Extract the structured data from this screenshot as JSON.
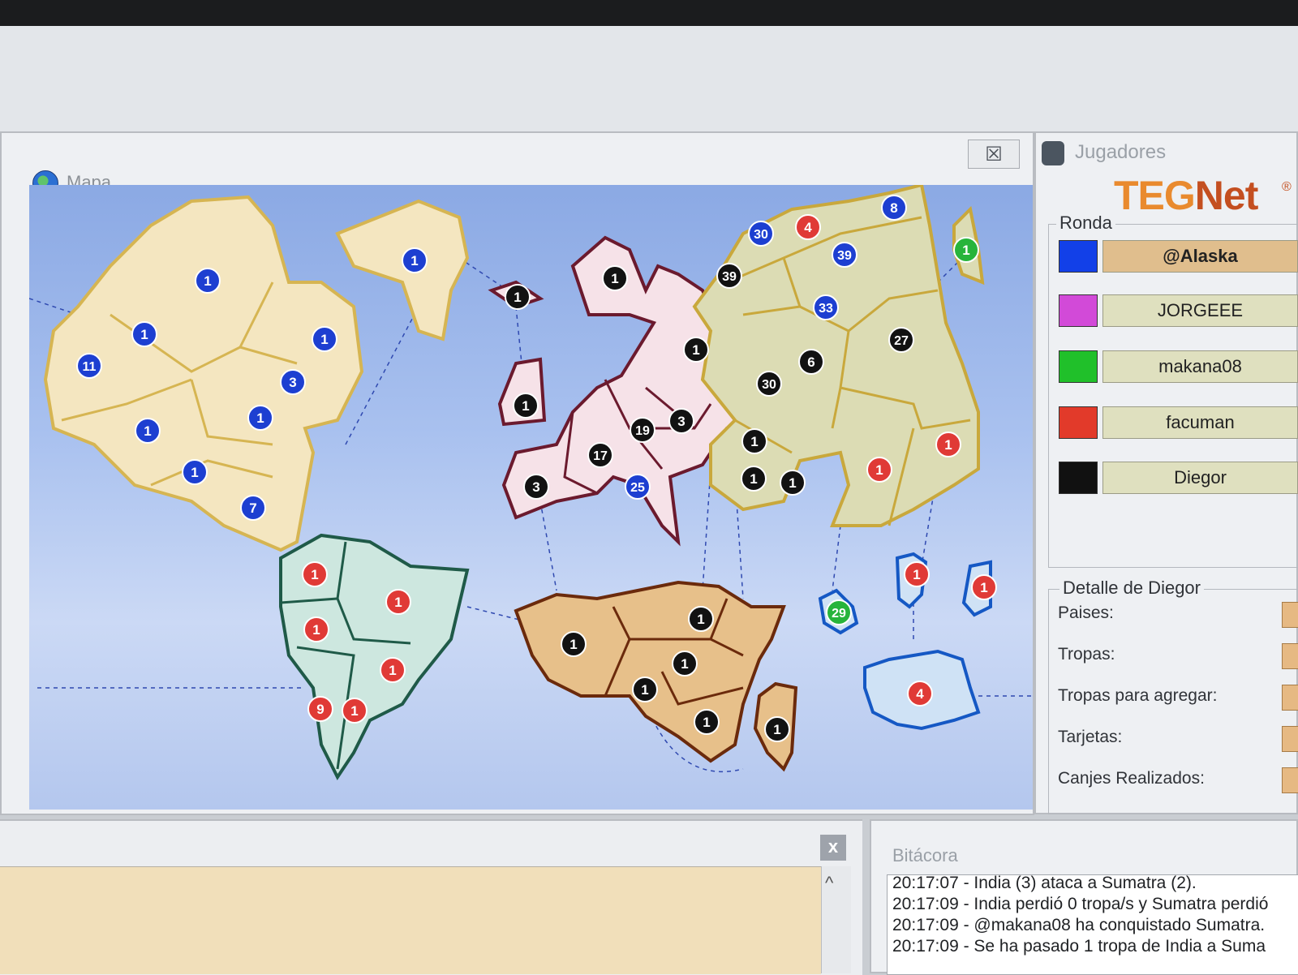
{
  "map_window": {
    "title": "Mapa",
    "close_label": "☒"
  },
  "players_window": {
    "title": "Jugadores",
    "brand_a": "TEG",
    "brand_b": "Net",
    "brand_mark": "®",
    "ronda_label": "Ronda",
    "players": [
      {
        "name": "@Alaska",
        "color": "#1240e8",
        "active": true
      },
      {
        "name": "JORGEEE",
        "color": "#d24ad8",
        "active": false
      },
      {
        "name": "makana08",
        "color": "#20c02a",
        "active": false
      },
      {
        "name": "facuman",
        "color": "#e23a2a",
        "active": false
      },
      {
        "name": "Diegor",
        "color": "#111111",
        "active": false
      }
    ],
    "detalle_label": "Detalle de Diegor",
    "stats": [
      "Paises:",
      "Tropas:",
      "Tropas para agregar:",
      "Tarjetas:",
      "Canjes Realizados:"
    ]
  },
  "chat_window": {
    "close_label": "x",
    "scroll_up": "^"
  },
  "log_window": {
    "title": "Bitácora",
    "lines": [
      "20:17:07 - India (3) ataca a Sumatra (2).",
      "20:17:09 - India perdió 0 tropa/s y Sumatra perdió",
      "20:17:09 - @makana08 ha conquistado Sumatra.",
      "20:17:09 - Se ha pasado 1 tropa de India a Suma"
    ]
  },
  "map": {
    "colors": {
      "blue": "#1d3fd1",
      "red": "#e03a36",
      "black": "#121212",
      "green": "#27b43b"
    },
    "markers": [
      {
        "label": "1",
        "owner": "blue"
      },
      {
        "label": "1",
        "owner": "blue"
      },
      {
        "label": "1",
        "owner": "blue"
      },
      {
        "label": "1",
        "owner": "blue"
      },
      {
        "label": "11",
        "owner": "blue"
      },
      {
        "label": "3",
        "owner": "blue"
      },
      {
        "label": "1",
        "owner": "blue"
      },
      {
        "label": "1",
        "owner": "blue"
      },
      {
        "label": "1",
        "owner": "blue"
      },
      {
        "label": "7",
        "owner": "blue"
      },
      {
        "label": "1",
        "owner": "red"
      },
      {
        "label": "1",
        "owner": "red"
      },
      {
        "label": "1",
        "owner": "red"
      },
      {
        "label": "1",
        "owner": "red"
      },
      {
        "label": "9",
        "owner": "red"
      },
      {
        "label": "1",
        "owner": "red"
      },
      {
        "label": "1",
        "owner": "black"
      },
      {
        "label": "1",
        "owner": "black"
      },
      {
        "label": "1",
        "owner": "black"
      },
      {
        "label": "1",
        "owner": "black"
      },
      {
        "label": "19",
        "owner": "black"
      },
      {
        "label": "3",
        "owner": "black"
      },
      {
        "label": "17",
        "owner": "black"
      },
      {
        "label": "3",
        "owner": "black"
      },
      {
        "label": "25",
        "owner": "blue"
      },
      {
        "label": "30",
        "owner": "blue"
      },
      {
        "label": "4",
        "owner": "red"
      },
      {
        "label": "8",
        "owner": "blue"
      },
      {
        "label": "39",
        "owner": "blue"
      },
      {
        "label": "39",
        "owner": "black"
      },
      {
        "label": "33",
        "owner": "blue"
      },
      {
        "label": "27",
        "owner": "black"
      },
      {
        "label": "6",
        "owner": "black"
      },
      {
        "label": "30",
        "owner": "black"
      },
      {
        "label": "1",
        "owner": "black"
      },
      {
        "label": "1",
        "owner": "black"
      },
      {
        "label": "1",
        "owner": "black"
      },
      {
        "label": "1",
        "owner": "red"
      },
      {
        "label": "1",
        "owner": "red"
      },
      {
        "label": "1",
        "owner": "green"
      },
      {
        "label": "1",
        "owner": "black"
      },
      {
        "label": "1",
        "owner": "black"
      },
      {
        "label": "1",
        "owner": "black"
      },
      {
        "label": "1",
        "owner": "black"
      },
      {
        "label": "1",
        "owner": "black"
      },
      {
        "label": "1",
        "owner": "black"
      },
      {
        "label": "29",
        "owner": "green"
      },
      {
        "label": "1",
        "owner": "red"
      },
      {
        "label": "1",
        "owner": "red"
      },
      {
        "label": "4",
        "owner": "red"
      }
    ]
  }
}
